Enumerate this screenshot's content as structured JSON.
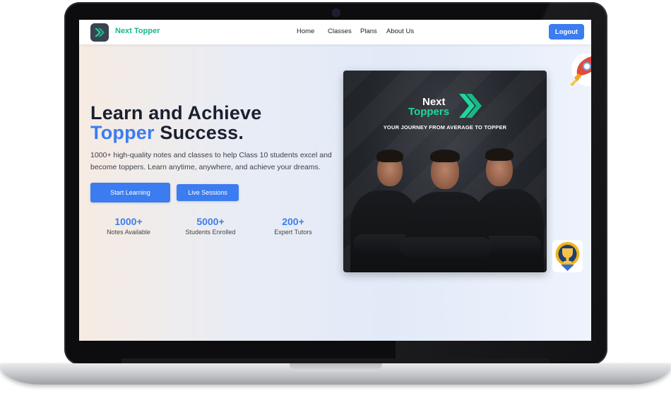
{
  "nav": {
    "brand": "Next Topper",
    "links": [
      "Home",
      "Classes",
      "Plans",
      "About Us"
    ],
    "logout_label": "Logout"
  },
  "hero": {
    "title_line1": "Learn and Achieve",
    "title_accent": "Topper",
    "title_rest": " Success.",
    "subtitle": "1000+ high-quality notes and classes to help Class 10 students excel and become toppers. Learn anytime, anywhere, and achieve your dreams.",
    "primary_cta": "Start Learning",
    "secondary_cta": "Live Sessions"
  },
  "stats": [
    {
      "value": "1000+",
      "label": "Notes Available"
    },
    {
      "value": "5000+",
      "label": "Students Enrolled"
    },
    {
      "value": "200+",
      "label": "Expert Tutors"
    }
  ],
  "poster": {
    "logo_line1": "Next",
    "logo_line2": "Toppers",
    "tagline": "YOUR JOURNEY FROM AVERAGE TO TOPPER"
  },
  "colors": {
    "accent": "#3b7df0",
    "brand_green": "#19b68a",
    "heading": "#1b2030"
  },
  "icons": {
    "logo": "chevron-arrow-icon",
    "rocket": "rocket-icon",
    "trophy": "trophy-icon"
  }
}
